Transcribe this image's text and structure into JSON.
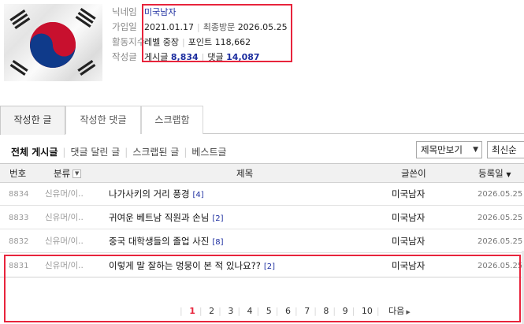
{
  "profile": {
    "labels": [
      "닉네임",
      "가입일",
      "활동지수",
      "작성글"
    ],
    "nickname": "미국남자",
    "join_date": "2021.01.17",
    "last_visit_label": "최종방문",
    "last_visit": "2026.05.25",
    "level_label": "레벨",
    "level": "중장",
    "points_label": "포인트",
    "points": "118,662",
    "posts_label": "게시글",
    "posts": "8,834",
    "comments_label": "댓글",
    "comments": "14,087"
  },
  "tabs": [
    "작성한 글",
    "작성한 댓글",
    "스크랩함"
  ],
  "filters": [
    "전체 게시글",
    "댓글 달린 글",
    "스크랩된 글",
    "베스트글"
  ],
  "select_sort": "제목만보기",
  "select_order": "최신순",
  "table": {
    "headers": {
      "no": "번호",
      "category": "분류",
      "title": "제목",
      "author": "글쓴이",
      "date": "등록일"
    },
    "rows": [
      {
        "no": "8834",
        "category": "신유머/이..",
        "title": "나가사키의 거리 풍경",
        "comments": "[4]",
        "author": "미국남자",
        "date": "2026.05.25"
      },
      {
        "no": "8833",
        "category": "신유머/이..",
        "title": "귀여운 베트남 직원과 손님",
        "comments": "[2]",
        "author": "미국남자",
        "date": "2026.05.25"
      },
      {
        "no": "8832",
        "category": "신유머/이..",
        "title": "중국 대학생들의 졸업 사진",
        "comments": "[8]",
        "author": "미국남자",
        "date": "2026.05.25"
      },
      {
        "no": "8831",
        "category": "신유머/이..",
        "title": "이렇게 말 잘하는 멍뭉이 본 적 있나요??",
        "comments": "[2]",
        "author": "미국남자",
        "date": "2026.05.25"
      }
    ]
  },
  "pagination": {
    "pages": [
      "1",
      "2",
      "3",
      "4",
      "5",
      "6",
      "7",
      "8",
      "9",
      "10"
    ],
    "current": "1",
    "next": "다음"
  },
  "colors": {
    "highlight": "#e8243c",
    "link_blue": "#1e2fa0",
    "header_bg": "#f1f1f1"
  }
}
